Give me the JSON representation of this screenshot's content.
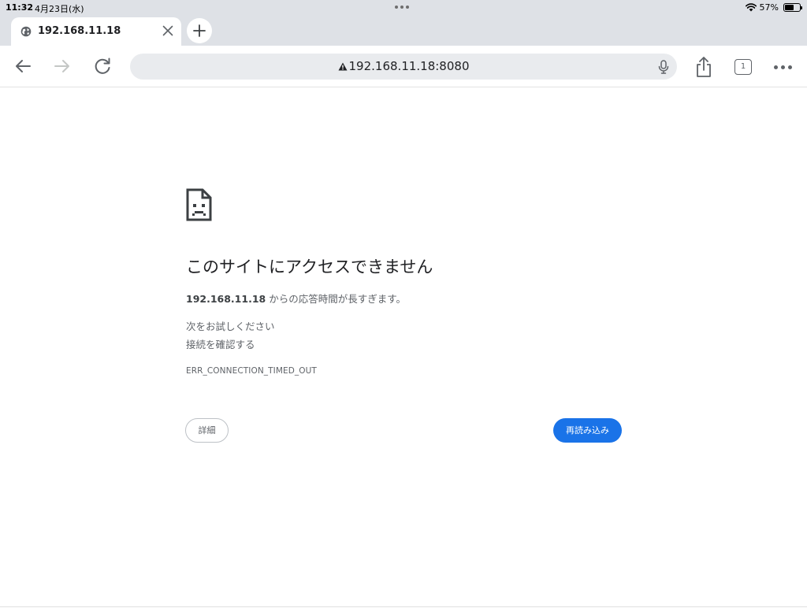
{
  "status_bar": {
    "time": "11:32",
    "date": "4月23日(水)",
    "battery_percent": "57%",
    "battery_level": 0.57,
    "icons": [
      "wifi-icon",
      "battery-icon"
    ]
  },
  "tab": {
    "title": "192.168.11.18",
    "icon": "globe-icon"
  },
  "toolbar": {
    "url": "192.168.11.18:8080",
    "security_icon": "warning-icon",
    "tab_count": "1",
    "icons": [
      "back-icon",
      "forward-icon",
      "reload-icon",
      "mic-icon",
      "share-icon",
      "more-icon"
    ]
  },
  "error_page": {
    "icon": "sad-page-icon",
    "heading": "このサイトにアクセスできません",
    "host": "192.168.11.18",
    "message_suffix": " からの応答時間が長すぎます。",
    "suggestions_heading": "次をお試しください",
    "suggestions": [
      "接続を確認する"
    ],
    "error_code": "ERR_CONNECTION_TIMED_OUT",
    "details_label": "詳細",
    "reload_label": "再読み込み"
  },
  "colors": {
    "chrome_bg": "#dee1e6",
    "omnibox_bg": "#e9ebee",
    "accent": "#1a73e8",
    "secondary_text": "#5f6368"
  }
}
